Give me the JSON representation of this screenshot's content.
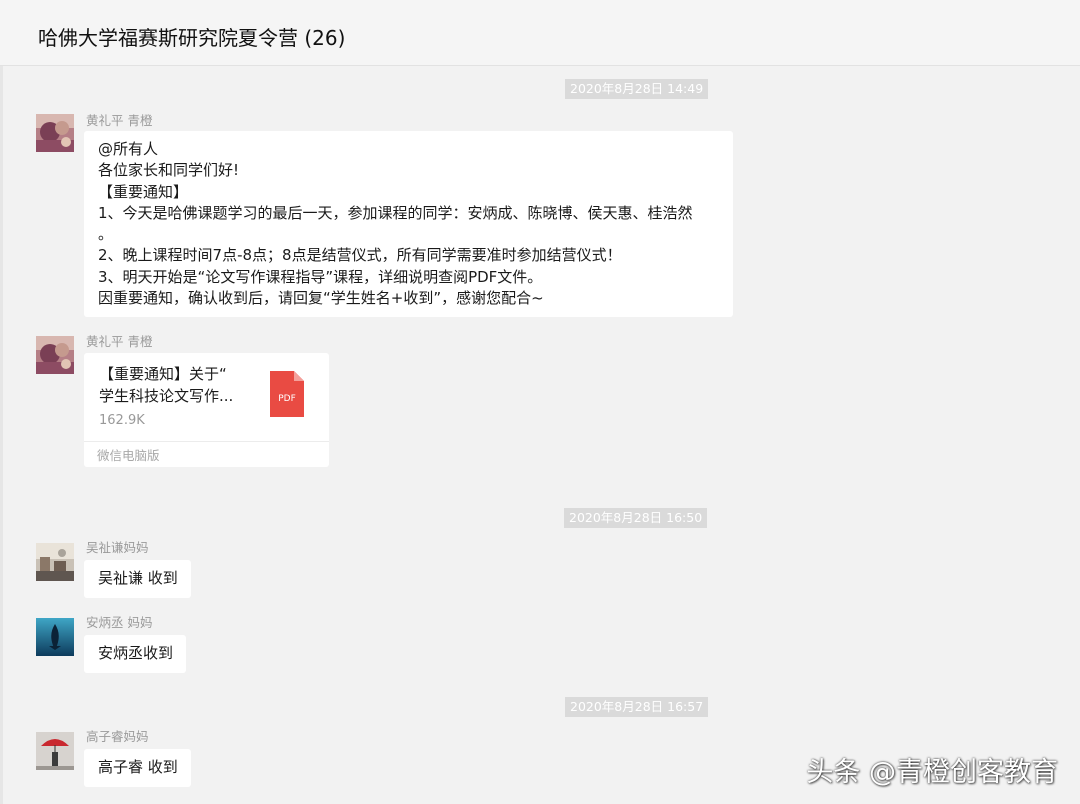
{
  "window": {
    "title": "哈佛大学福赛斯研究院夏令营 (26)"
  },
  "timestamps": [
    "2020年8月28日 14:49",
    "2020年8月28日 16:50",
    "2020年8月28日 16:57"
  ],
  "messages": [
    {
      "sender": "黄礼平  青橙",
      "lines": [
        "@所有人",
        "各位家长和同学们好!",
        "【重要通知】",
        "1、今天是哈佛课题学习的最后一天，参加课程的同学：安炳成、陈晓博、侯天惠、桂浩然",
        "。",
        "2、晚上课程时间7点-8点；8点是结营仪式，所有同学需要准时参加结营仪式！",
        "3、明天开始是“论文写作课程指导”课程，详细说明查阅PDF文件。",
        "因重要通知，确认收到后，请回复“学生姓名+收到”，感谢您配合~"
      ]
    },
    {
      "sender": "黄礼平  青橙",
      "file": {
        "name_line1": "【重要通知】关于“",
        "name_line2": "学生科技论文写作...",
        "size": "162.9K",
        "source": "微信电脑版",
        "icon_label": "PDF"
      }
    },
    {
      "sender": "吴祉谦妈妈",
      "text": "吴祉谦 收到"
    },
    {
      "sender": "安炳丞 妈妈",
      "text": "安炳丞收到"
    },
    {
      "sender": "高子睿妈妈",
      "text": "高子睿 收到"
    }
  ],
  "watermark": "头条 @青橙创客教育",
  "colors": {
    "background": "#f2f2f2",
    "bubble": "#ffffff",
    "timestamp_bg": "#dadada",
    "pdf_red": "#e94b43"
  }
}
